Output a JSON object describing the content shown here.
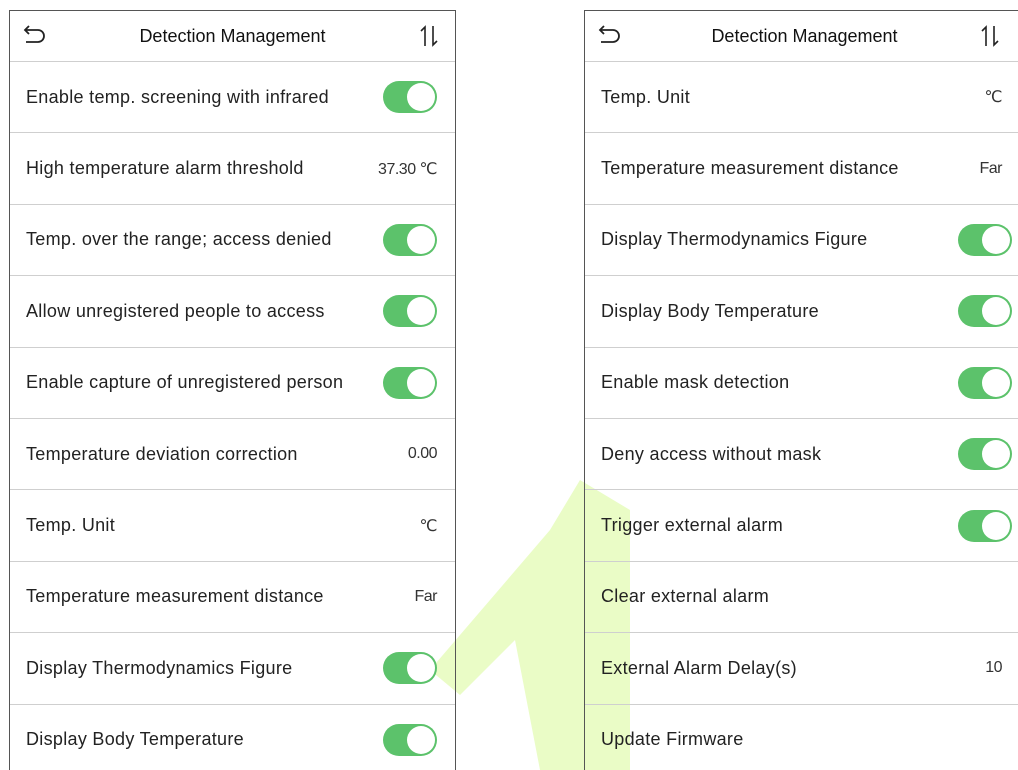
{
  "colors": {
    "accent": "#5cc26b",
    "divider": "#cfcfcf",
    "watermark": "#e9fbc4"
  },
  "left_screen": {
    "title": "Detection Management",
    "rows": [
      {
        "label": "Enable temp. screening with infrared",
        "toggle": true
      },
      {
        "label": "High temperature alarm threshold",
        "value": "37.30 ℃"
      },
      {
        "label": "Temp. over the range; access denied",
        "toggle": true
      },
      {
        "label": "Allow unregistered people to access",
        "toggle": true
      },
      {
        "label": "Enable capture of unregistered person",
        "toggle": true
      },
      {
        "label": "Temperature deviation correction",
        "value": "0.00"
      },
      {
        "label": "Temp. Unit",
        "value": "℃"
      },
      {
        "label": "Temperature measurement distance",
        "value": "Far"
      },
      {
        "label": "Display Thermodynamics Figure",
        "toggle": true
      },
      {
        "label": "Display Body Temperature",
        "toggle": true
      }
    ]
  },
  "right_screen": {
    "title": "Detection Management",
    "rows": [
      {
        "label": "Temp. Unit",
        "value": "℃"
      },
      {
        "label": "Temperature measurement distance",
        "value": "Far"
      },
      {
        "label": "Display Thermodynamics Figure",
        "toggle": true
      },
      {
        "label": "Display Body Temperature",
        "toggle": true
      },
      {
        "label": "Enable mask detection",
        "toggle": true
      },
      {
        "label": "Deny access without mask",
        "toggle": true
      },
      {
        "label": "Trigger external alarm",
        "toggle": true
      },
      {
        "label": "Clear external alarm"
      },
      {
        "label": "External Alarm Delay(s)",
        "value": "10"
      },
      {
        "label": "Update Firmware"
      }
    ]
  },
  "icons": {
    "back": "back-arrow-icon",
    "sort": "sort-arrows-icon"
  }
}
